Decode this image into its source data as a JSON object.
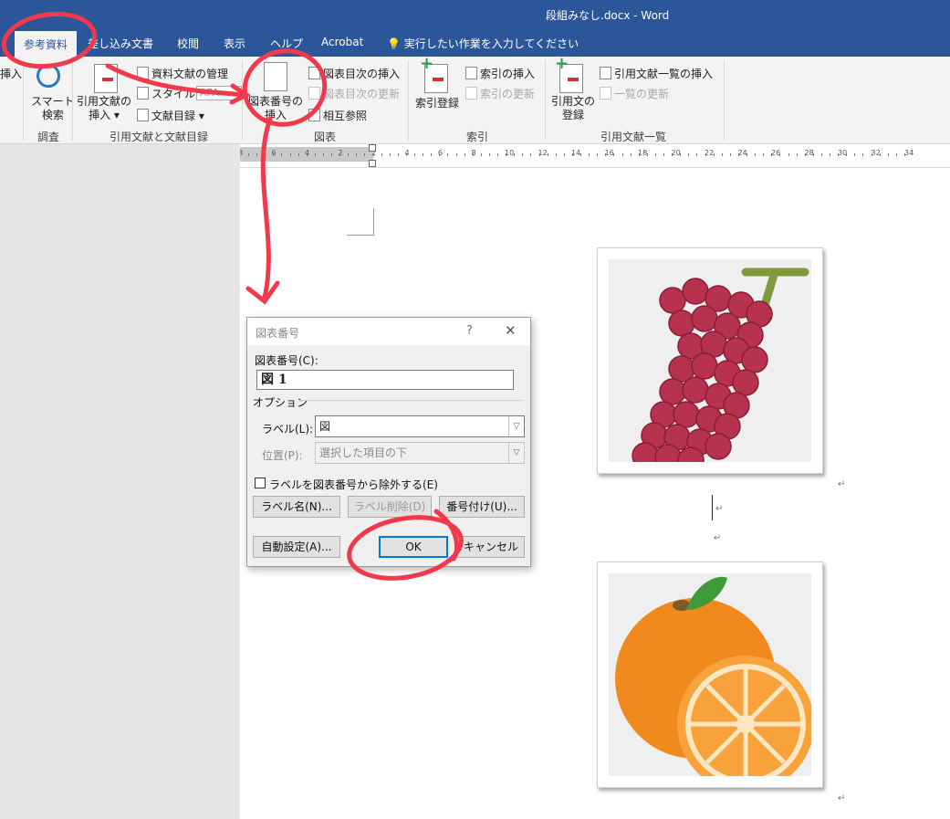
{
  "window": {
    "title": "段組みなし.docx  -  Word"
  },
  "tabs": [
    {
      "label": "参考資料",
      "active": true
    },
    {
      "label": "差し込み文書"
    },
    {
      "label": "校閲"
    },
    {
      "label": "表示"
    },
    {
      "label": "ヘルプ"
    },
    {
      "label": "Acrobat"
    }
  ],
  "tell_me": {
    "placeholder": "実行したい作業を入力してください",
    "icon": "lightbulb-icon"
  },
  "ribbon": {
    "cut_off_label": "挿入",
    "groups": {
      "research": {
        "label": "調査",
        "smart_lookup": "スマート\n検索"
      },
      "citations": {
        "label": "引用文献と文献目録",
        "insert_citation": "引用文献の\n挿入 ▾",
        "manage_sources": "資料文献の管理",
        "style_label": "スタイル:",
        "style_value": "APA",
        "bibliography": "文献目録 ▾"
      },
      "captions": {
        "label": "図表",
        "insert_caption": "図表番号の\n挿入",
        "insert_table_of_figures": "図表目次の挿入",
        "update_table": "図表目次の更新",
        "cross_reference": "相互参照"
      },
      "index": {
        "label": "索引",
        "mark_entry": "索引登録",
        "insert_index": "索引の挿入",
        "update_index": "索引の更新"
      },
      "table_of_authorities": {
        "label": "引用文献一覧",
        "mark_citation": "引用文の\n登録",
        "insert_table": "引用文献一覧の挿入",
        "update_table": "一覧の更新"
      }
    }
  },
  "ruler": {
    "numbers": [
      "8",
      "6",
      "4",
      "2",
      "2",
      "4",
      "6",
      "8",
      "10",
      "12",
      "14",
      "16",
      "18",
      "20",
      "22",
      "24",
      "26",
      "28",
      "30",
      "32",
      "34"
    ]
  },
  "document": {
    "paragraph_mark": "↵"
  },
  "dialog": {
    "title": "図表番号",
    "help": "?",
    "close": "✕",
    "caption_label": "図表番号(C):",
    "caption_value": "図  1",
    "options_label": "オプション",
    "label_label": "ラベル(L):",
    "label_value": "図",
    "position_label": "位置(P):",
    "position_value": "選択した項目の下",
    "exclude_label": "ラベルを図表番号から除外する(E)",
    "new_label_button": "ラベル名(N)...",
    "delete_label_button": "ラベル削除(D)",
    "numbering_button": "番号付け(U)...",
    "autocaption_button": "自動設定(A)...",
    "ok_button": "OK",
    "cancel_button": "キャンセル"
  },
  "colors": {
    "word_blue": "#2b579a",
    "annotation_red": "#f03a4c",
    "focus_blue": "#0078d7"
  }
}
